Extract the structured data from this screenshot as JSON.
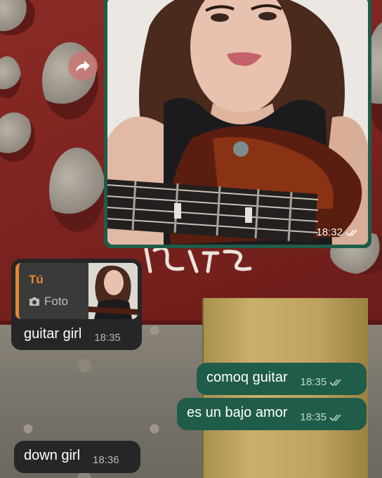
{
  "chat": {
    "image_message": {
      "time": "18:32",
      "status_icon": "double-check-icon"
    },
    "forward_icon": "forward-arrow-icon",
    "reply_message": {
      "quote_author": "Tú",
      "quote_type_icon": "camera-icon",
      "quote_type": "Foto",
      "text": "guitar girl",
      "time": "18:35"
    },
    "messages": [
      {
        "direction": "outgoing",
        "text": "comoq guitar",
        "time": "18:35",
        "status_icon": "double-check-icon"
      },
      {
        "direction": "outgoing",
        "text": "es un bajo amor",
        "time": "18:35",
        "status_icon": "double-check-icon"
      },
      {
        "direction": "incoming",
        "text": "down girl",
        "time": "18:36"
      }
    ]
  },
  "colors": {
    "outgoing_bubble": "#1f5c4a",
    "incoming_bubble": "#262626",
    "quote_accent": "#e8872e"
  }
}
